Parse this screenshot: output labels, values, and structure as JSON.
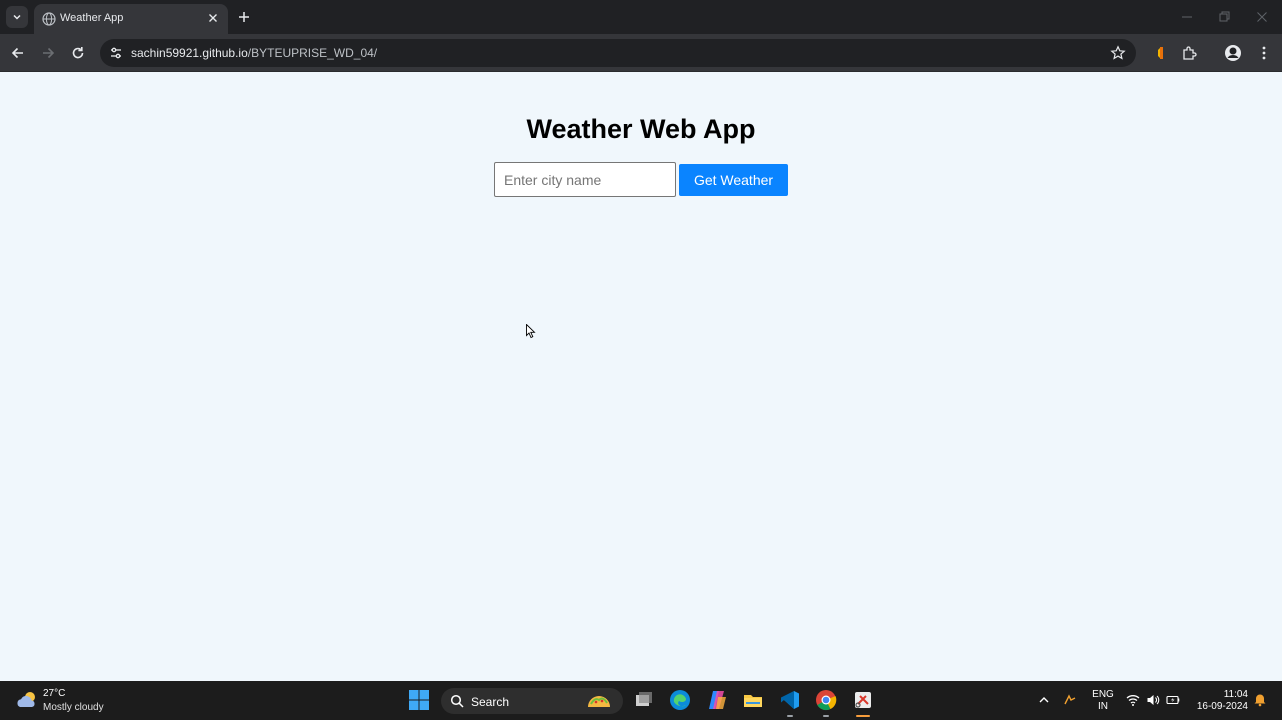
{
  "browser": {
    "tab": {
      "title": "Weather App"
    },
    "address": {
      "host": "sachin59921.github.io",
      "path": "/BYTEUPRISE_WD_04/"
    }
  },
  "app": {
    "title": "Weather Web App",
    "city_input": {
      "value": "",
      "placeholder": "Enter city name"
    },
    "submit_label": "Get Weather"
  },
  "taskbar": {
    "weather": {
      "temp": "27°C",
      "condition": "Mostly cloudy"
    },
    "search_label": "Search",
    "language": {
      "line1": "ENG",
      "line2": "IN"
    },
    "clock": {
      "time": "11:04",
      "date": "16-09-2024"
    }
  },
  "colors": {
    "page_bg": "#f0f7fc",
    "button_bg": "#0a84ff",
    "chrome_dark": "#202124",
    "toolbar": "#35363a",
    "taskbar": "#1c1c1c"
  }
}
